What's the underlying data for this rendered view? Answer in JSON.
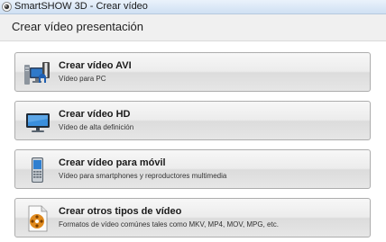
{
  "window": {
    "title": "SmartSHOW 3D - Crear vídeo",
    "app_icon": "smartshow-app-icon"
  },
  "page": {
    "heading": "Crear vídeo presentación"
  },
  "options": [
    {
      "title": "Crear vídeo AVI",
      "subtitle": "Vídeo para PC",
      "icon": "pc-video-icon"
    },
    {
      "title": "Crear vídeo HD",
      "subtitle": "Vídeo de alta definición",
      "icon": "hd-tv-icon"
    },
    {
      "title": "Crear vídeo para móvil",
      "subtitle": "Vídeo para smartphones y reproductores multimedia",
      "icon": "mobile-phone-icon"
    },
    {
      "title": "Crear otros tipos de vídeo",
      "subtitle": "Formatos de vídeo comúnes tales como MKV, MP4, MOV, MPG, etc.",
      "icon": "video-file-icon"
    }
  ]
}
